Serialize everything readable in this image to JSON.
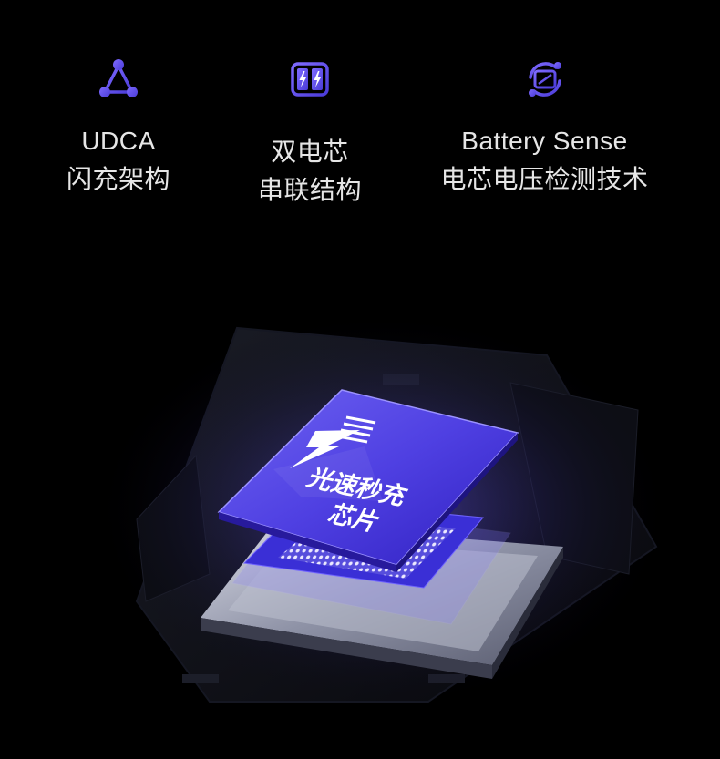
{
  "features": [
    {
      "icon": "triangle-network-icon",
      "line1": "UDCA",
      "line2": "闪充架构"
    },
    {
      "icon": "dual-battery-bolt-icon",
      "line1": "双电芯",
      "line2": "串联结构"
    },
    {
      "icon": "battery-sense-icon",
      "line1": "Battery Sense",
      "line2": "电芯电压检测技术"
    }
  ],
  "chip": {
    "label_line1": "光速秒充",
    "label_line2": "芯片"
  },
  "colors": {
    "accent": "#6b5cff",
    "chip_top": "#5b4be0",
    "background": "#000000"
  }
}
